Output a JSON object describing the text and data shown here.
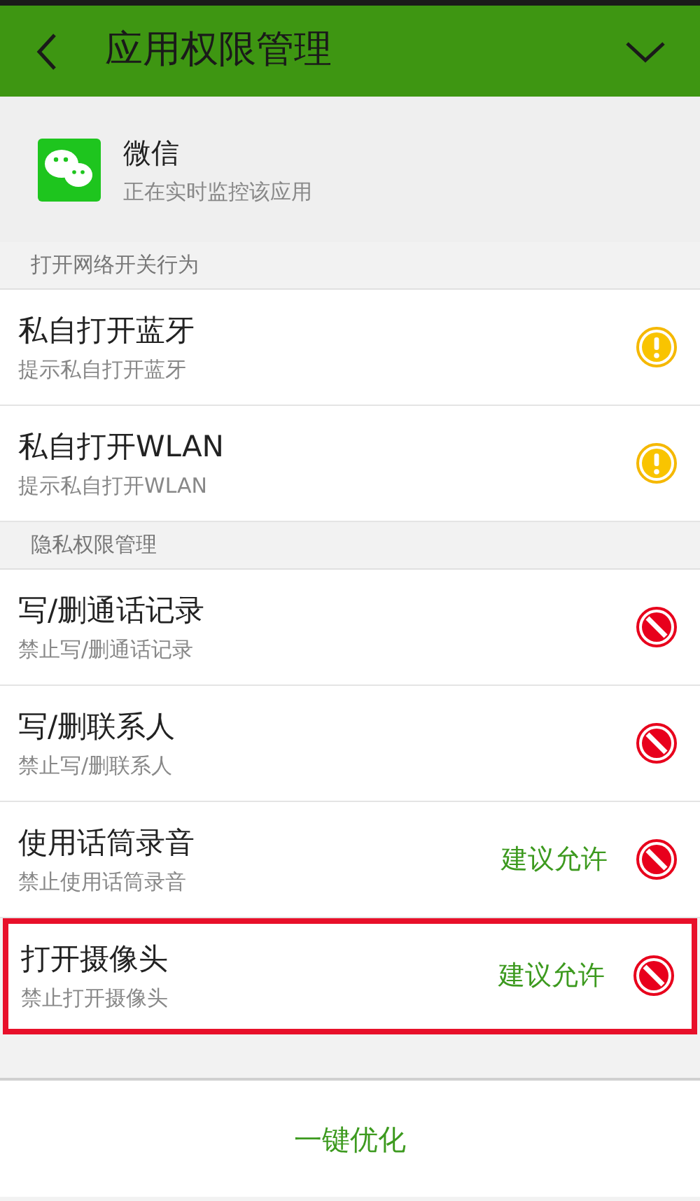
{
  "header": {
    "title": "应用权限管理"
  },
  "app": {
    "name": "微信",
    "status": "正在实时监控该应用"
  },
  "sections": [
    {
      "title": "打开网络开关行为",
      "items": [
        {
          "title": "私自打开蓝牙",
          "subtitle": "提示私自打开蓝牙",
          "kind": "warn",
          "highlighted": false
        },
        {
          "title": "私自打开WLAN",
          "subtitle": "提示私自打开WLAN",
          "kind": "warn",
          "highlighted": false
        }
      ]
    },
    {
      "title": "隐私权限管理",
      "items": [
        {
          "title": "写/删通话记录",
          "subtitle": "禁止写/删通话记录",
          "kind": "block",
          "highlighted": false
        },
        {
          "title": "写/删联系人",
          "subtitle": "禁止写/删联系人",
          "kind": "block",
          "highlighted": false
        },
        {
          "title": "使用话筒录音",
          "subtitle": "禁止使用话筒录音",
          "kind": "block",
          "suggestion": "建议允许",
          "highlighted": false
        },
        {
          "title": "打开摄像头",
          "subtitle": "禁止打开摄像头",
          "kind": "block",
          "suggestion": "建议允许",
          "highlighted": true
        }
      ]
    }
  ],
  "bottom_button": "一键优化"
}
